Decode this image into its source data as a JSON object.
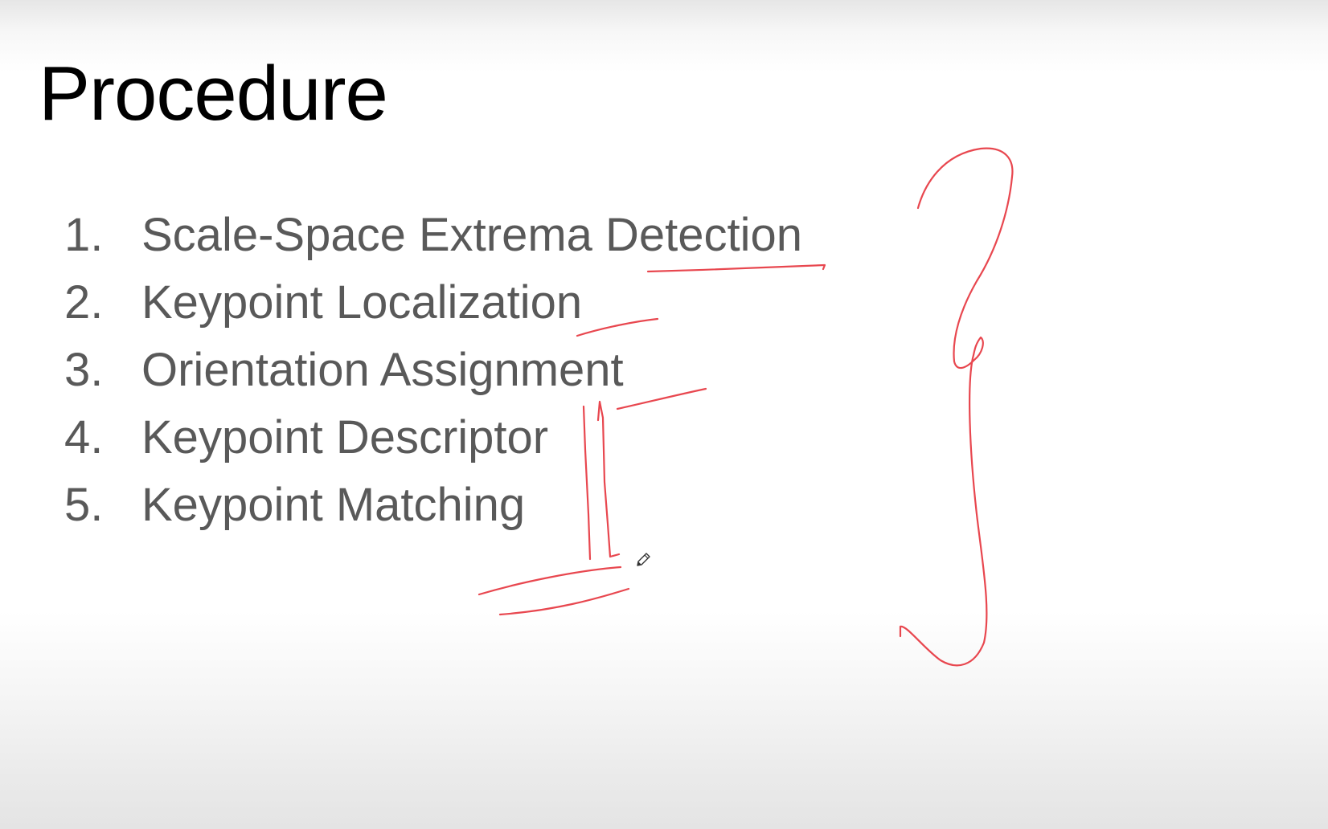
{
  "slide": {
    "title": "Procedure",
    "steps": [
      {
        "number": "1.",
        "text": "Scale-Space Extrema Detection"
      },
      {
        "number": "2.",
        "text": "Keypoint Localization"
      },
      {
        "number": "3.",
        "text": "Orientation Assignment"
      },
      {
        "number": "4.",
        "text": "Keypoint Descriptor"
      },
      {
        "number": "5.",
        "text": "Keypoint Matching"
      }
    ]
  },
  "annotation": {
    "ink_color": "#e8474f",
    "cursor_icon": "pencil-icon"
  }
}
